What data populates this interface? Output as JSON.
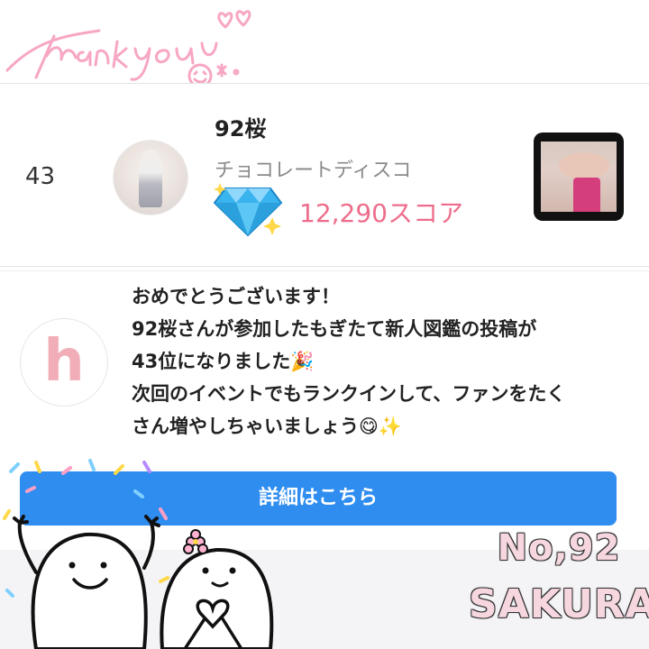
{
  "header": {
    "handwriting": "Thank you"
  },
  "ranking": {
    "rank": "43",
    "name": "92桜",
    "shop": "チョコレートディスコ",
    "score": "12,290スコア",
    "score_color": "#ee6d8c",
    "badge_icon": "diamond-icon"
  },
  "notification": {
    "logo_letter": "h",
    "lines": [
      "おめでとうございます！",
      "92桜さんが参加したもぎたて新人図鑑の投稿が",
      "43位になりました🎉",
      "次回のイベントでもランクインして、ファンをたく",
      "さん増やしちゃいましょう😋✨"
    ],
    "button_label": "詳細はこちら",
    "button_color": "#2f8df0"
  },
  "signature": {
    "number": "No,92",
    "name": "SAKURA"
  }
}
